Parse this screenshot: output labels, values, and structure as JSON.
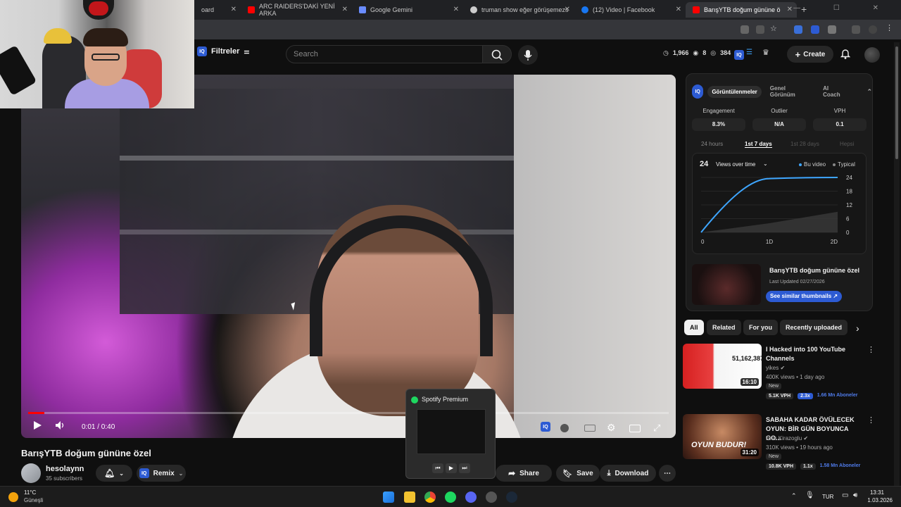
{
  "browser": {
    "tabs": [
      {
        "title": "oard",
        "color": "#888888"
      },
      {
        "title": "ARC RAIDERS'DAKİ YENİ ARKA",
        "color": "#ff0000"
      },
      {
        "title": "Google Gemini",
        "color": "#6a8cff"
      },
      {
        "title": "truman show eğer görüşemezs",
        "color": "#cccccc"
      },
      {
        "title": "(12) Video | Facebook",
        "color": "#1877f2"
      },
      {
        "title": "BarışYTB doğum gününe ö",
        "color": "#ff0000"
      }
    ],
    "new_tab": "+"
  },
  "youtube_header": {
    "filters_label": "Filtreler",
    "search_placeholder": "Search",
    "stats": {
      "views": "1,966",
      "videos": "8",
      "watching": "384"
    },
    "create_label": "Create"
  },
  "video": {
    "time": "0:01 / 0:40",
    "progress_fraction": 0.025,
    "title": "BarışYTB doğum gününe özel",
    "channel_name": "hesolaynn",
    "channel_subs": "35 subscribers",
    "actions": {
      "remix": "Remix",
      "share": "Share",
      "save": "Save",
      "download": "Download"
    }
  },
  "spotify_popup": {
    "title": "Spotify Premium"
  },
  "iq_panel": {
    "tabs": [
      "Görüntülenmeler",
      "Genel Görünüm",
      "AI Coach"
    ],
    "metrics": [
      {
        "label": "Engagement",
        "value": "8.3%"
      },
      {
        "label": "Outlier",
        "value": "N/A"
      },
      {
        "label": "VPH",
        "value": "0.1"
      }
    ],
    "ranges": [
      "24 hours",
      "1st 7 days",
      "1st 28 days",
      "Hepsi"
    ],
    "chart_header": {
      "value": "24",
      "dropdown": "Views over time",
      "legend_this": "Bu video",
      "legend_typical": "Typical"
    },
    "thumb_title": "BarışYTB doğum gününe özel",
    "last_updated": "Last Updated 02/27/2026",
    "similar_button": "See similar thumbnails ↗"
  },
  "chart_data": {
    "type": "line",
    "x": [
      "0",
      "1D",
      "2D"
    ],
    "y_ticks": [
      24,
      18,
      12,
      6,
      0
    ],
    "ylim": [
      0,
      24
    ],
    "series": [
      {
        "name": "Bu video",
        "values": [
          0,
          23.5,
          24
        ],
        "color": "#3ea6ff"
      },
      {
        "name": "Typical",
        "values": [
          0,
          4,
          9
        ],
        "color": "#888888"
      }
    ]
  },
  "chips": [
    "All",
    "Related",
    "For you",
    "Recently uploaded"
  ],
  "recommendations": [
    {
      "title": "I Hacked into 100 YouTube Channels",
      "channel": "yikes",
      "meta": "400K views • 1 day ago",
      "new": "New",
      "duration": "16:10",
      "thumb_text": "51,162,387",
      "badges": [
        "5.1K VPH",
        "2.3x",
        "1.66 Mn Aboneler"
      ]
    },
    {
      "title": "SABAHA KADAR ÖVÜLECEK OYUN: BİR GÜN BOYUNCA GO...",
      "channel": "Enis Kirazoglu",
      "meta": "310K views • 19 hours ago",
      "new": "New",
      "duration": "31:20",
      "thumb_text": "OYUN BUDUR!",
      "badges": [
        "10.8K VPH",
        "1.1x",
        "1.58 Mn Aboneler"
      ]
    }
  ],
  "taskbar": {
    "temp": "11°C",
    "condition": "Güneşli",
    "lang": "TUR",
    "time": "13:31",
    "date": "1.03.2026"
  },
  "colors": {
    "accent": "#3ea6ff",
    "yt_red": "#ff0000",
    "iq_blue": "#2d5bd3"
  }
}
